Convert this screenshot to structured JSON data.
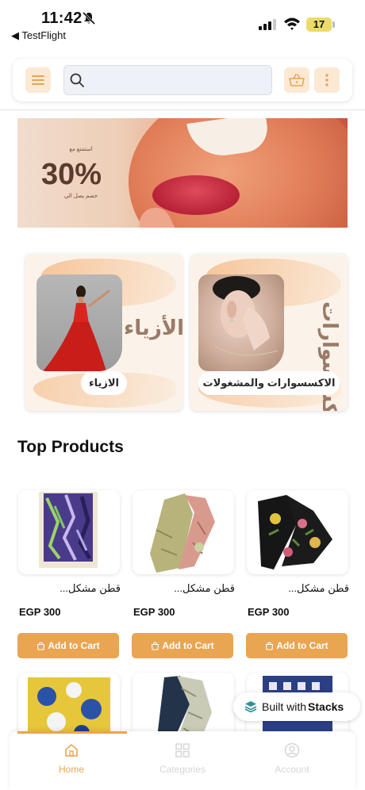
{
  "status_bar": {
    "time": "11:42",
    "back_app": "◀ TestFlight",
    "battery": "17"
  },
  "header": {
    "search_placeholder": "",
    "icons": [
      "menu-icon",
      "search-icon",
      "basket-icon",
      "more-vertical-icon"
    ]
  },
  "banner": {
    "small_text": "استمتع مع",
    "discount": "30%",
    "sub_text": "خصم يصل الي"
  },
  "categories": [
    {
      "label": "الاكسسوارات والمشغولات",
      "title": "الاكسسوارات"
    },
    {
      "label": "الازياء",
      "title": "الأزياء"
    }
  ],
  "section_title": "Top Products",
  "products": [
    {
      "name": "قطن مشكل...",
      "price": "EGP 300",
      "button": "Add to Cart"
    },
    {
      "name": "قطن مشكل...",
      "price": "EGP 300",
      "button": "Add to Cart"
    },
    {
      "name": "قطن مشكل...",
      "price": "EGP 300",
      "button": "Add to Cart"
    }
  ],
  "stacks_badge": {
    "prefix": "Built with ",
    "brand": "Stacks"
  },
  "bottom_nav": [
    {
      "label": "Home",
      "icon": "home-icon",
      "active": true
    },
    {
      "label": "Categories",
      "icon": "grid-icon",
      "active": false
    },
    {
      "label": "Account",
      "icon": "account-icon",
      "active": false
    }
  ],
  "colors": {
    "accent": "#e9a552",
    "accent_soft": "#fbe9d4",
    "nav_inactive": "#d6d6d6"
  }
}
